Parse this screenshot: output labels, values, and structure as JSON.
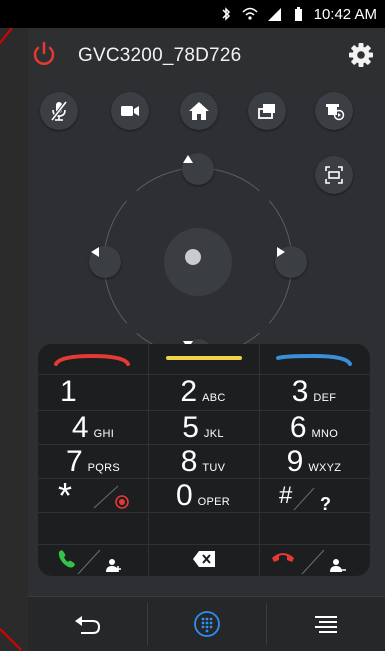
{
  "status_bar": {
    "time": "10:42 AM",
    "icons": [
      "bluetooth-icon",
      "wifi-icon",
      "cell-signal-icon",
      "battery-icon"
    ]
  },
  "header": {
    "device_name": "GVC3200_78D726",
    "power_icon": "power-icon",
    "settings_icon": "gear-icon"
  },
  "toolbar": {
    "buttons": [
      {
        "name": "mute-mic-button",
        "icon": "microphone-muted-icon"
      },
      {
        "name": "camera-button",
        "icon": "video-camera-icon"
      },
      {
        "name": "home-button",
        "icon": "home-icon"
      },
      {
        "name": "presentation-button",
        "icon": "screen-share-icon"
      },
      {
        "name": "camera-preset-button",
        "icon": "camera-preset-icon"
      }
    ],
    "fullscreen_icon": "fullscreen-icon"
  },
  "dpad": {
    "icons": [
      "arrow-up-icon",
      "arrow-left-icon",
      "center-ok-icon",
      "arrow-right-icon",
      "arrow-down-icon"
    ]
  },
  "colors": {
    "accent_red": "#e53935",
    "accent_yellow": "#f0d34a",
    "accent_blue": "#3a8fd8",
    "highlight_blue": "#2f8ff0",
    "panel_bg": "#2d2f32",
    "dialpad_bg": "#1d1e20"
  },
  "dialpad": {
    "keys": [
      {
        "digit": "1",
        "letters": ""
      },
      {
        "digit": "2",
        "letters": "ABC"
      },
      {
        "digit": "3",
        "letters": "DEF"
      },
      {
        "digit": "4",
        "letters": "GHI"
      },
      {
        "digit": "5",
        "letters": "JKL"
      },
      {
        "digit": "6",
        "letters": "MNO"
      },
      {
        "digit": "7",
        "letters": "PQRS"
      },
      {
        "digit": "8",
        "letters": "TUV"
      },
      {
        "digit": "9",
        "letters": "WXYZ"
      },
      {
        "digit": "*",
        "letters": ""
      },
      {
        "digit": "0",
        "letters": "OPER"
      },
      {
        "digit": "#",
        "letters": ""
      }
    ],
    "hash_secondary": "?"
  },
  "bottom_nav": {
    "items": [
      "back-icon",
      "dialpad-icon",
      "menu-icon"
    ],
    "active": "dialpad-icon"
  }
}
